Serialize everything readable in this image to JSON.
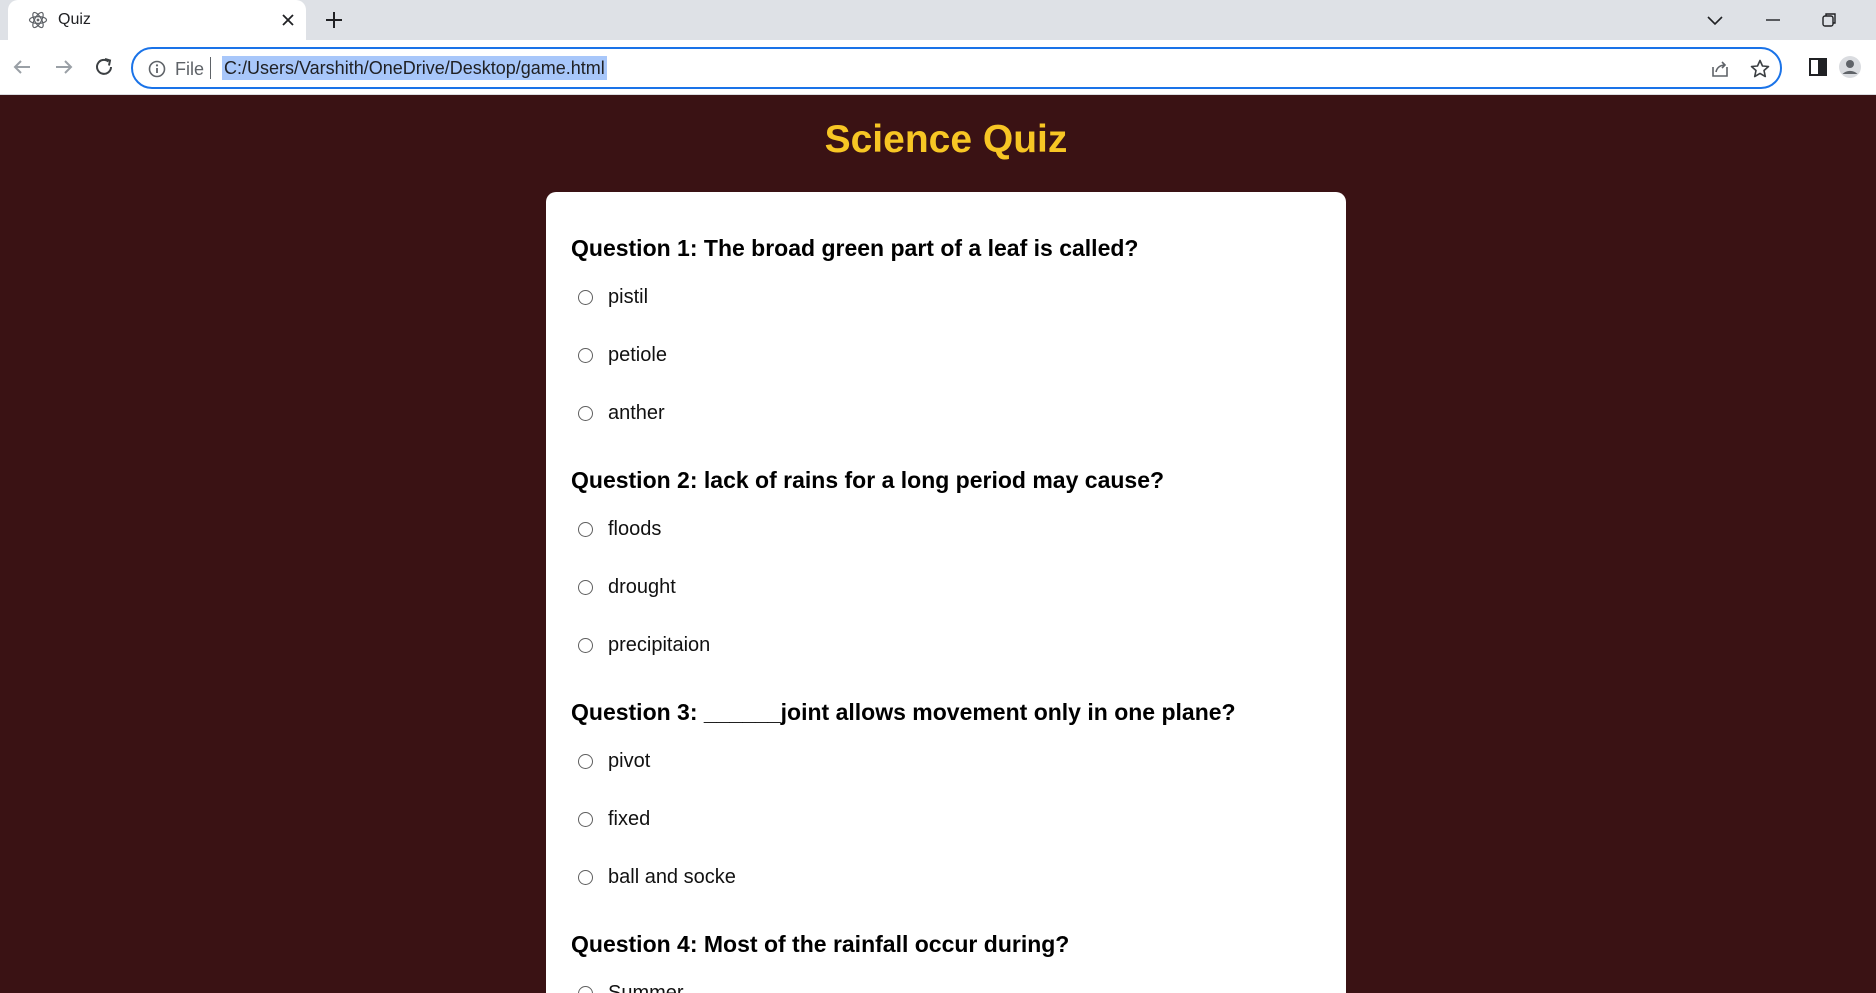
{
  "browser": {
    "tab_title": "Quiz",
    "scheme_label": "File",
    "url": "C:/Users/Varshith/OneDrive/Desktop/game.html"
  },
  "page": {
    "title": "Science Quiz",
    "questions": [
      {
        "label": "Question 1: The broad green part of a leaf is called?",
        "options": [
          "pistil",
          "petiole",
          "anther"
        ]
      },
      {
        "label": "Question 2: lack of rains for a long period may cause?",
        "options": [
          "floods",
          "drought",
          "precipitaion"
        ]
      },
      {
        "label": "Question 3: ______joint allows movement only in one plane?",
        "options": [
          "pivot",
          "fixed",
          "ball and socke"
        ]
      },
      {
        "label": "Question 4: Most of the rainfall occur during?",
        "options": [
          "Summer"
        ]
      }
    ]
  },
  "colors": {
    "page_background": "#3a1214",
    "title": "#f7c624",
    "card": "#ffffff",
    "omnibox_focus": "#1a73e8",
    "url_selection": "#a8c7fa"
  },
  "icons": {
    "favicon": "atom-icon",
    "tab_close": "close-icon",
    "new_tab": "plus-icon",
    "back": "arrow-left-icon",
    "forward": "arrow-right-icon",
    "reload": "reload-icon",
    "site_info": "info-icon",
    "share": "share-icon",
    "bookmark": "star-icon",
    "side_panel": "side-panel-icon",
    "profile": "profile-icon"
  }
}
